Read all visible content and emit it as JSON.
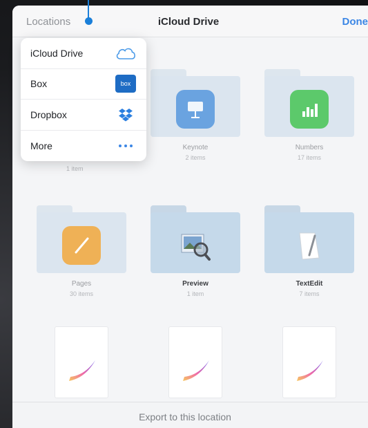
{
  "navbar": {
    "locations_label": "Locations",
    "title": "iCloud Drive",
    "done_label": "Done"
  },
  "locations_menu": {
    "items": [
      {
        "label": "iCloud Drive",
        "icon": "cloud-icon"
      },
      {
        "label": "Box",
        "icon": "box-icon",
        "badge_text": "box"
      },
      {
        "label": "Dropbox",
        "icon": "dropbox-icon"
      },
      {
        "label": "More",
        "icon": "more-icon"
      }
    ]
  },
  "folders": [
    {
      "name": "Keynote",
      "count": "2 items",
      "icon": "keynote-icon",
      "dim": true
    },
    {
      "name": "Numbers",
      "count": "17 items",
      "icon": "numbers-icon",
      "dim": true
    },
    {
      "name": "Pages",
      "count": "30 items",
      "icon": "pages-icon",
      "dim": true
    },
    {
      "name": "Preview",
      "count": "1 item",
      "icon": "preview-icon",
      "dim": false
    },
    {
      "name": "TextEdit",
      "count": "7 items",
      "icon": "textedit-icon",
      "dim": false
    }
  ],
  "hidden_first_folder_count": "1 item",
  "documents": [
    {
      "icon": "procreate-icon"
    },
    {
      "icon": "procreate-icon"
    },
    {
      "icon": "procreate-icon"
    }
  ],
  "bottombar": {
    "label": "Export to this location"
  },
  "colors": {
    "accent": "#3b86e5",
    "pointer": "#1a7fd9",
    "folder": "#c5d9ea",
    "box_brand": "#1e6cc4"
  }
}
